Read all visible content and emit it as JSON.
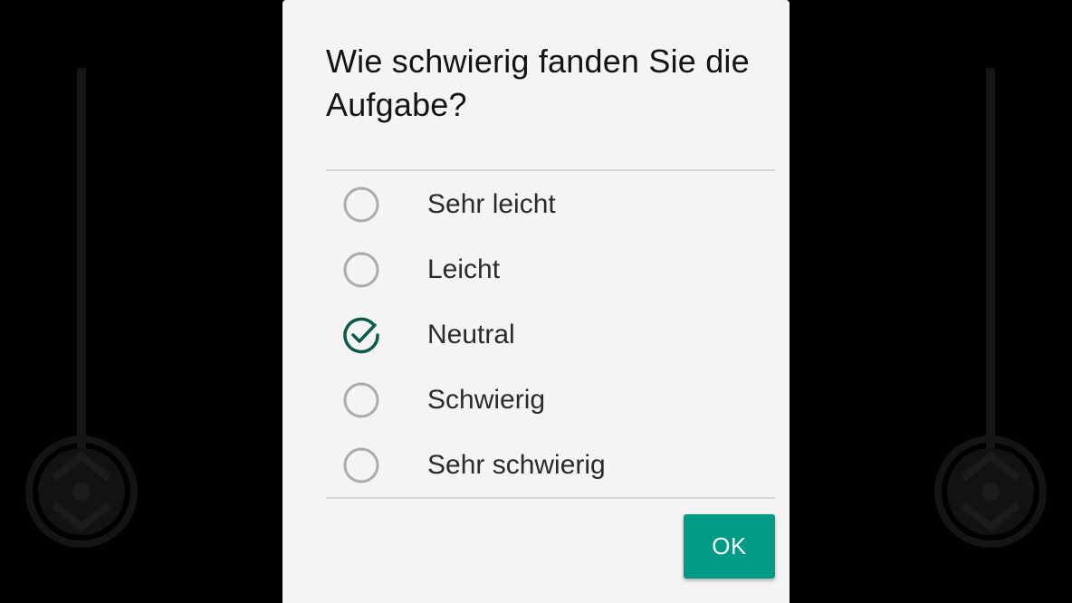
{
  "dialog": {
    "title": "Wie schwierig fanden Sie die Aufgabe?",
    "options": [
      {
        "label": "Sehr leicht",
        "selected": false
      },
      {
        "label": "Leicht",
        "selected": false
      },
      {
        "label": "Neutral",
        "selected": true
      },
      {
        "label": "Schwierig",
        "selected": false
      },
      {
        "label": "Sehr schwierig",
        "selected": false
      }
    ],
    "ok_label": "OK"
  },
  "icons": {
    "radio_unchecked": "radio-unchecked-icon",
    "radio_checked": "check-circle-icon",
    "background_control": "vertical-joystick-icon"
  },
  "colors": {
    "accent": "#009b87",
    "checked": "#0b5a4a",
    "unchecked": "#ababab",
    "dialog_background": "#f4f4f4",
    "screen_background": "#000000"
  }
}
